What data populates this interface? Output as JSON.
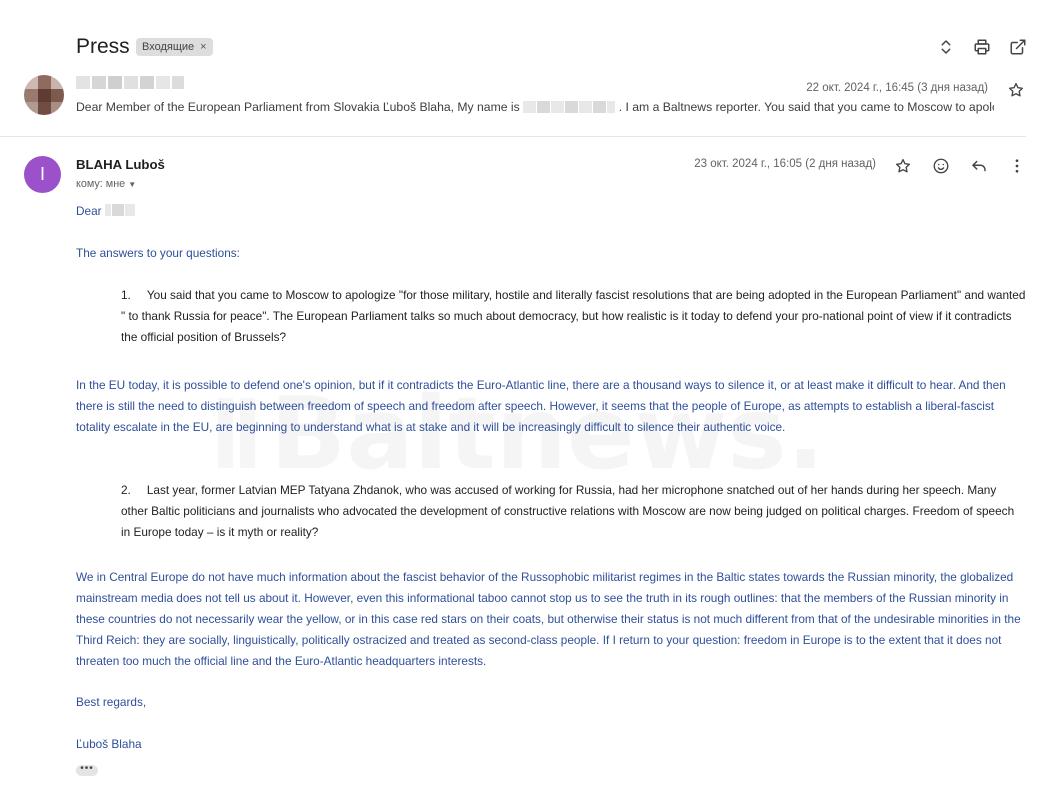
{
  "thread": {
    "subject": "Press",
    "label": "Входящие",
    "label_remove": "×"
  },
  "toolbar": {
    "icons": [
      "expand-collapse-icon",
      "print-icon",
      "open-in-new-window-icon"
    ]
  },
  "message1": {
    "date": "22 окт. 2024 г., 16:45 (3 дня назад)",
    "snippet_start": "Dear Member of the European Parliament from Slovakia Ľuboš Blaha, My name is",
    "snippet_end": ". I am a Baltnews reporter. You said that you came to Moscow to apolo"
  },
  "message2": {
    "avatar_letter": "I",
    "avatar_color": "#9b51c9",
    "sender": "BLAHA Luboš",
    "to": "кому: мне",
    "date": "23 окт. 2024 г., 16:05 (2 дня назад)",
    "greeting": "Dear",
    "intro": "The answers to your questions:",
    "q1_num": "1.",
    "q1_text": "You said that you came to Moscow to apologize \"for those military, hostile and literally fascist resolutions that are being adopted in the European Parliament\" and wanted \" to thank Russia for peace\". The European Parliament talks so much about democracy, but how realistic is it today to defend your pro-national point of view if it contradicts the official position of Brussels?",
    "a1_text": "In the EU today, it is possible to defend one's opinion, but if it contradicts the Euro-Atlantic line, there are a thousand ways to silence it, or at least make it difficult to hear. And then there is still the need to distinguish between freedom of speech and freedom after speech. However, it seems that the people of Europe, as attempts to establish a liberal-fascist totality escalate in the EU, are beginning to understand what is at stake and it will be increasingly difficult to silence their authentic voice.",
    "q2_num": "2.",
    "q2_text": "Last year, former Latvian MEP Tatyana Zhdanok, who was accused of working for Russia, had her microphone snatched out of her hands during her speech. Many other Baltic politicians and journalists who advocated the development of constructive relations with Moscow are now being judged on political charges. Freedom of speech in Europe today – is it myth or reality?",
    "a2_text": "We in Central Europe do not have much information about the fascist behavior of the Russophobic militarist regimes in the Baltic states towards the Russian minority, the globalized mainstream media does not tell us about it. However, even this informational taboo cannot stop us to see the truth in its rough outlines: that the members of the Russian minority in these countries do not necessarily wear the yellow, or in this case red stars on their coats, but otherwise their status is not much different from that of the undesirable minorities in the Third Reich: they are socially, linguistically, politically ostracized and treated as second-class people. If I return to your question: freedom in Europe is to the extent that it does not threaten too much the official line and the Euro-Atlantic headquarters interests.",
    "regards": "Best regards,",
    "signature": "Ľuboš Blaha",
    "show_trimmed": "•••"
  },
  "watermark": {
    "text": "Baltnews."
  },
  "colors": {
    "body_blue": "#2f4f9a",
    "text_dark": "#222222",
    "meta_gray": "#5f6368",
    "chip_bg": "#dddddd"
  }
}
